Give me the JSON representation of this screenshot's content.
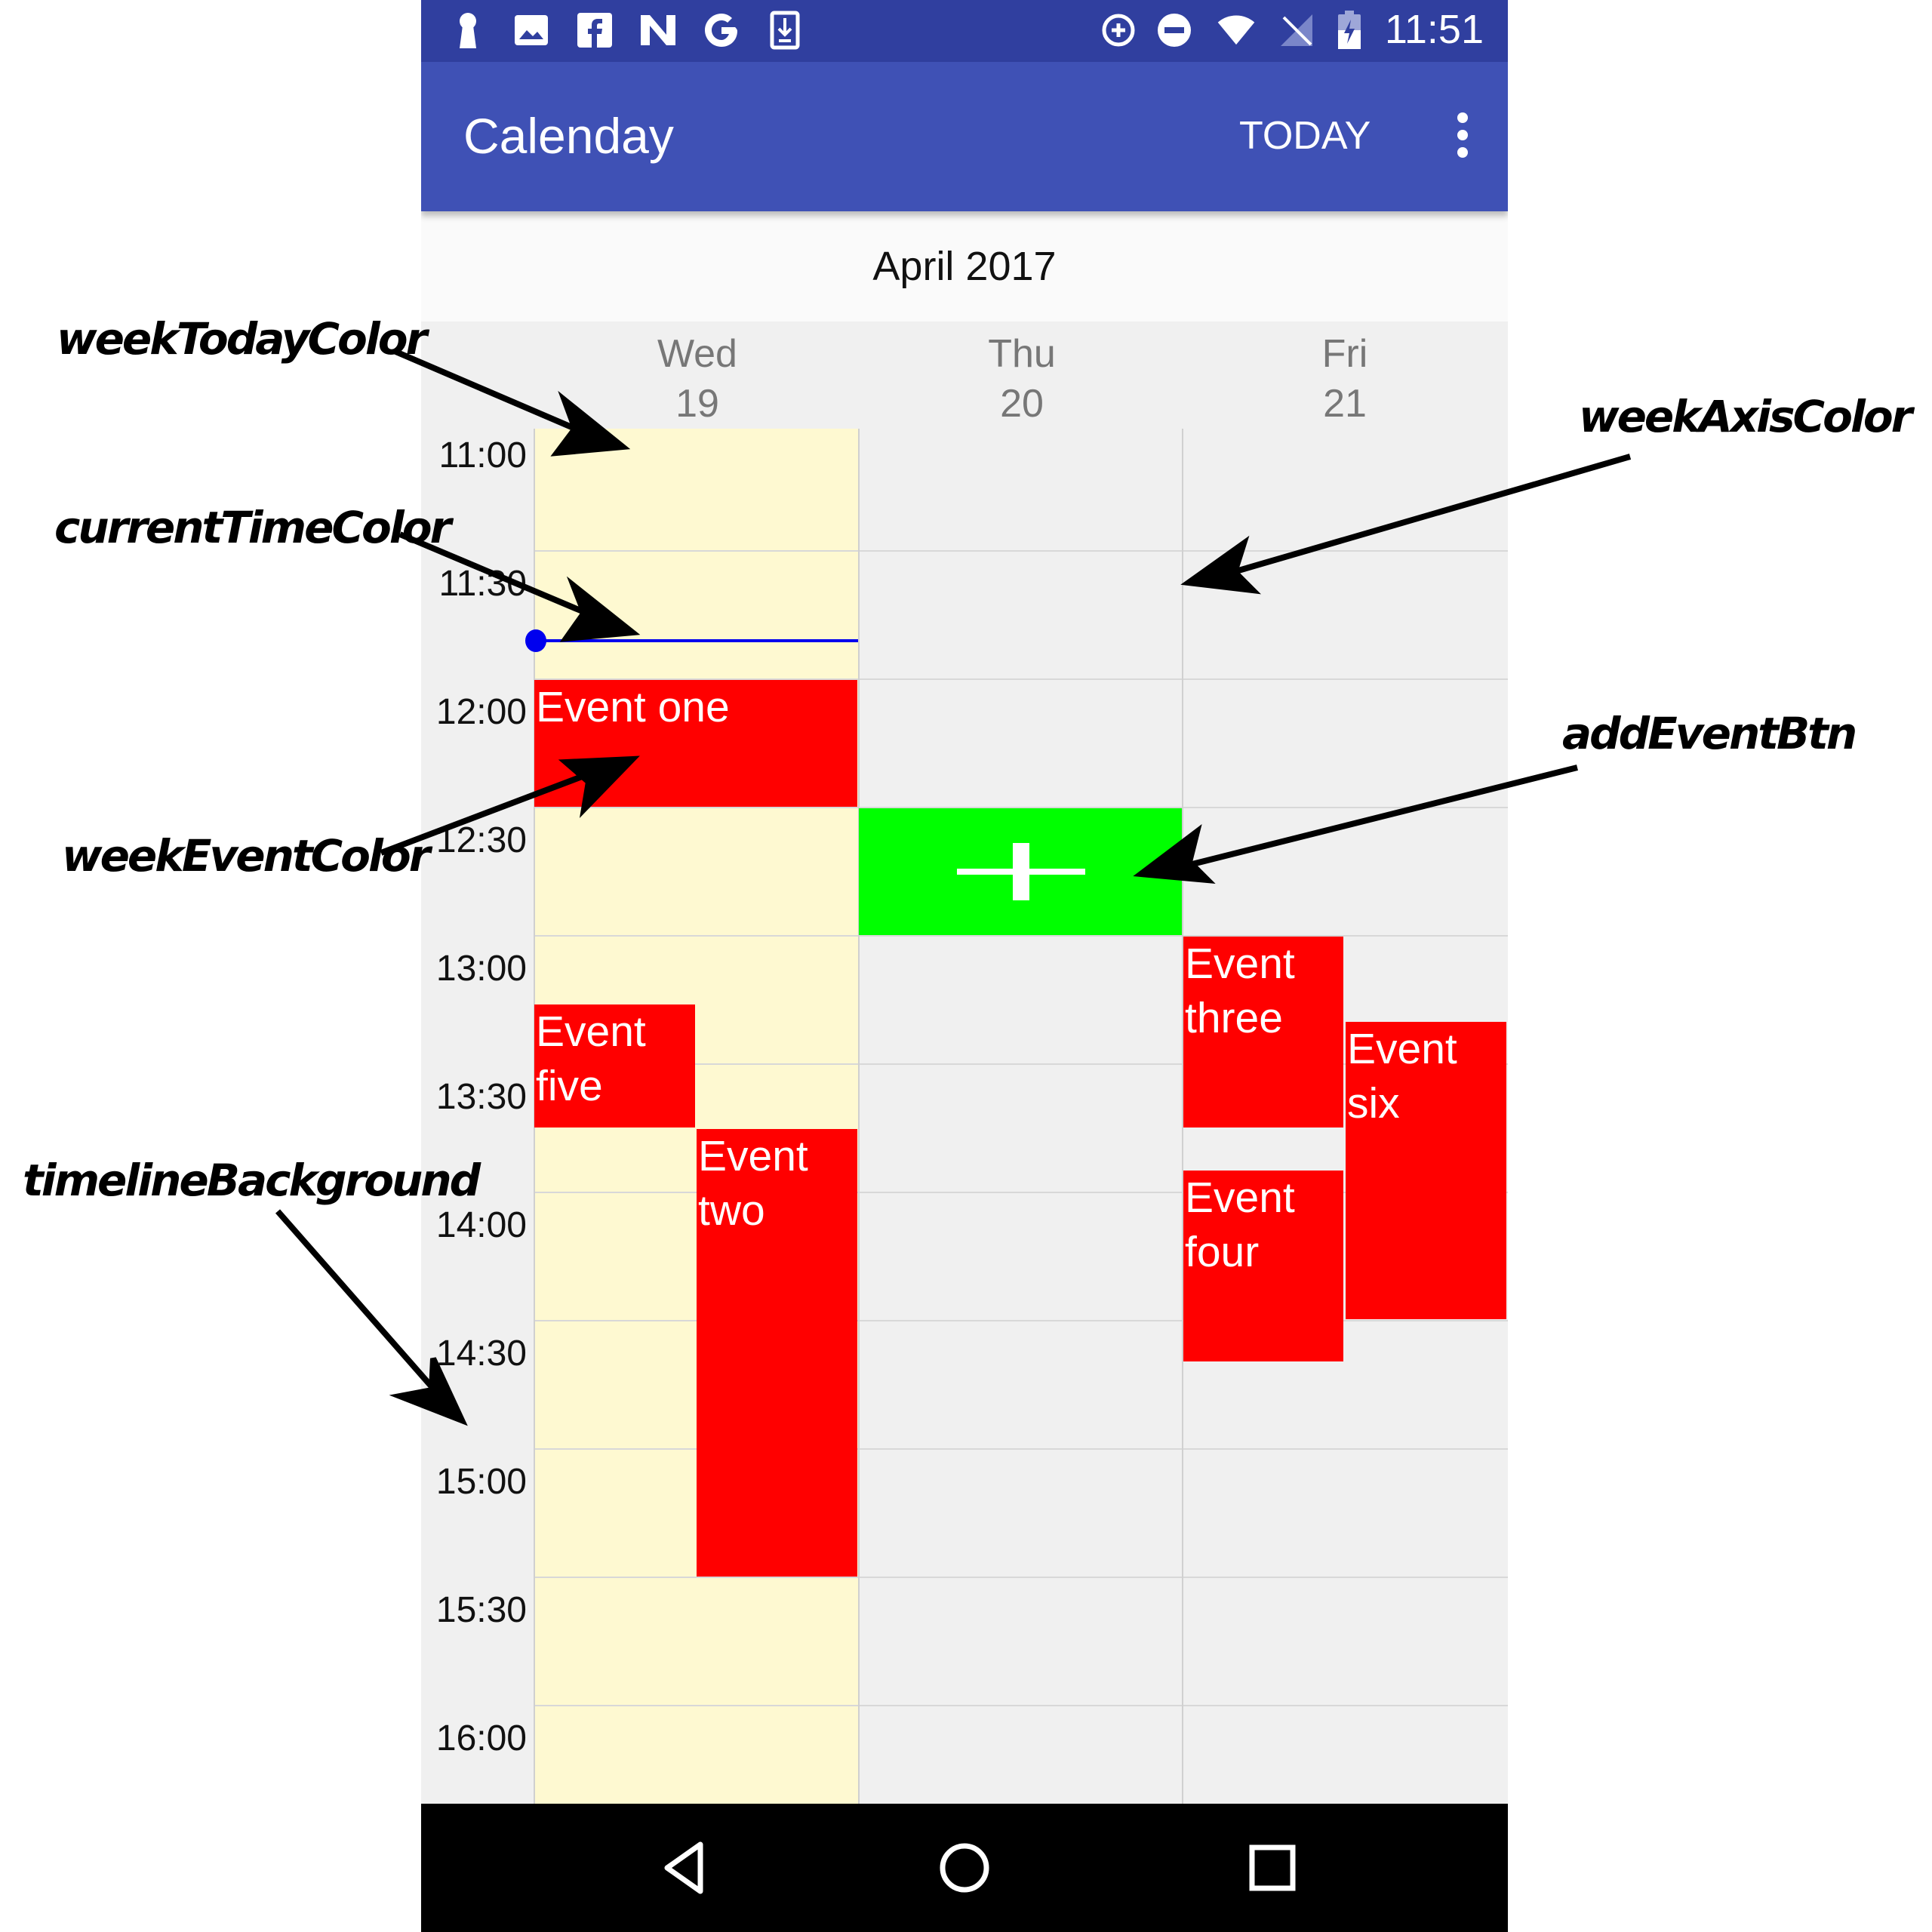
{
  "status_bar": {
    "time": "11:51",
    "left_icons": [
      "keyhole-icon",
      "image-icon",
      "facebook-icon",
      "nova-icon",
      "google-icon",
      "download-icon"
    ],
    "right_icons": [
      "data-saver-icon",
      "do-not-disturb-icon",
      "wifi-icon",
      "no-signal-icon",
      "battery-charging-icon"
    ]
  },
  "toolbar": {
    "title": "Calenday",
    "today_label": "TODAY",
    "menu_icon": "more-vert-icon"
  },
  "month_label": "April 2017",
  "days": [
    {
      "name": "Wed",
      "date": "19",
      "is_today": true
    },
    {
      "name": "Thu",
      "date": "20",
      "is_today": false
    },
    {
      "name": "Fri",
      "date": "21",
      "is_today": false
    }
  ],
  "time_labels": [
    "11:00",
    "11:30",
    "12:00",
    "12:30",
    "13:00",
    "13:30",
    "14:00",
    "14:30",
    "15:00",
    "15:30",
    "16:00"
  ],
  "events": [
    {
      "title": "Event one",
      "day": "Wed",
      "start": "12:00",
      "end": "12:30"
    },
    {
      "title": "Event five",
      "day": "Wed",
      "start": "13:15",
      "end": "13:45"
    },
    {
      "title": "Event two",
      "day": "Wed",
      "start": "13:45",
      "end": "15:30"
    },
    {
      "title": "Event three",
      "day": "Fri",
      "start": "13:00",
      "end": "13:45"
    },
    {
      "title": "Event four",
      "day": "Fri",
      "start": "13:55",
      "end": "14:40"
    },
    {
      "title": "Event six",
      "day": "Fri",
      "start": "13:20",
      "end": "14:30"
    }
  ],
  "current_time": "11:51",
  "add_event_button": {
    "icon": "plus-icon",
    "day": "Thu",
    "start": "12:30",
    "end": "13:00"
  },
  "colors": {
    "status_bar": "#303f9f",
    "toolbar": "#3f51b5",
    "week_today": "#fef9d1",
    "week_event": "#ff0000",
    "current_time": "#0000ee",
    "add_event": "#00ff00",
    "timeline_background": "#f0f0f0"
  },
  "nav_bar": {
    "icons": [
      "back-icon",
      "home-icon",
      "recents-icon"
    ]
  },
  "annotations": {
    "week_today_color": "weekTodayColor",
    "current_time_color": "currentTimeColor",
    "week_event_color": "weekEventColor",
    "timeline_background": "timelineBackground",
    "week_axis_color": "weekAxisColor",
    "add_event_btn": "addEventBtn"
  }
}
